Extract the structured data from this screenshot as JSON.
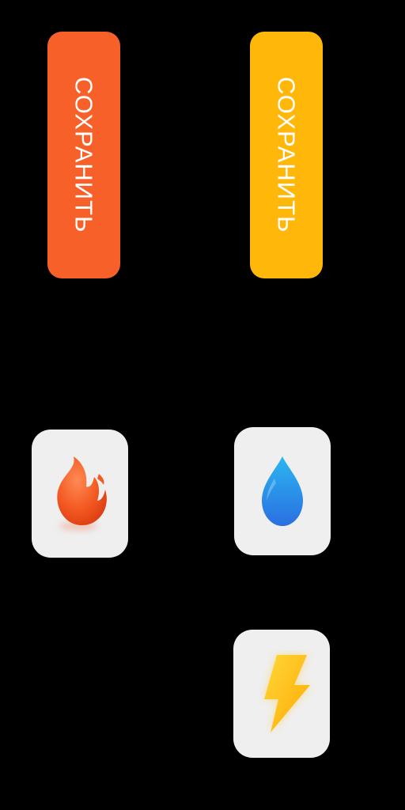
{
  "buttons": [
    {
      "id": "orange",
      "label": "СОХРАНИТЬ",
      "color": "#f8602a"
    },
    {
      "id": "yellow",
      "label": "СОХРАНИТЬ",
      "color": "#ffb80a"
    }
  ],
  "icon_tiles": [
    {
      "id": "fire",
      "icon": "fire-icon",
      "color": "#f0531f",
      "background": "#efefef"
    },
    {
      "id": "water",
      "icon": "water-drop-icon",
      "color": "#2a8de6",
      "background": "#efefef"
    },
    {
      "id": "bolt",
      "icon": "lightning-bolt-icon",
      "color": "#ffc21a",
      "background": "#efefef"
    }
  ]
}
